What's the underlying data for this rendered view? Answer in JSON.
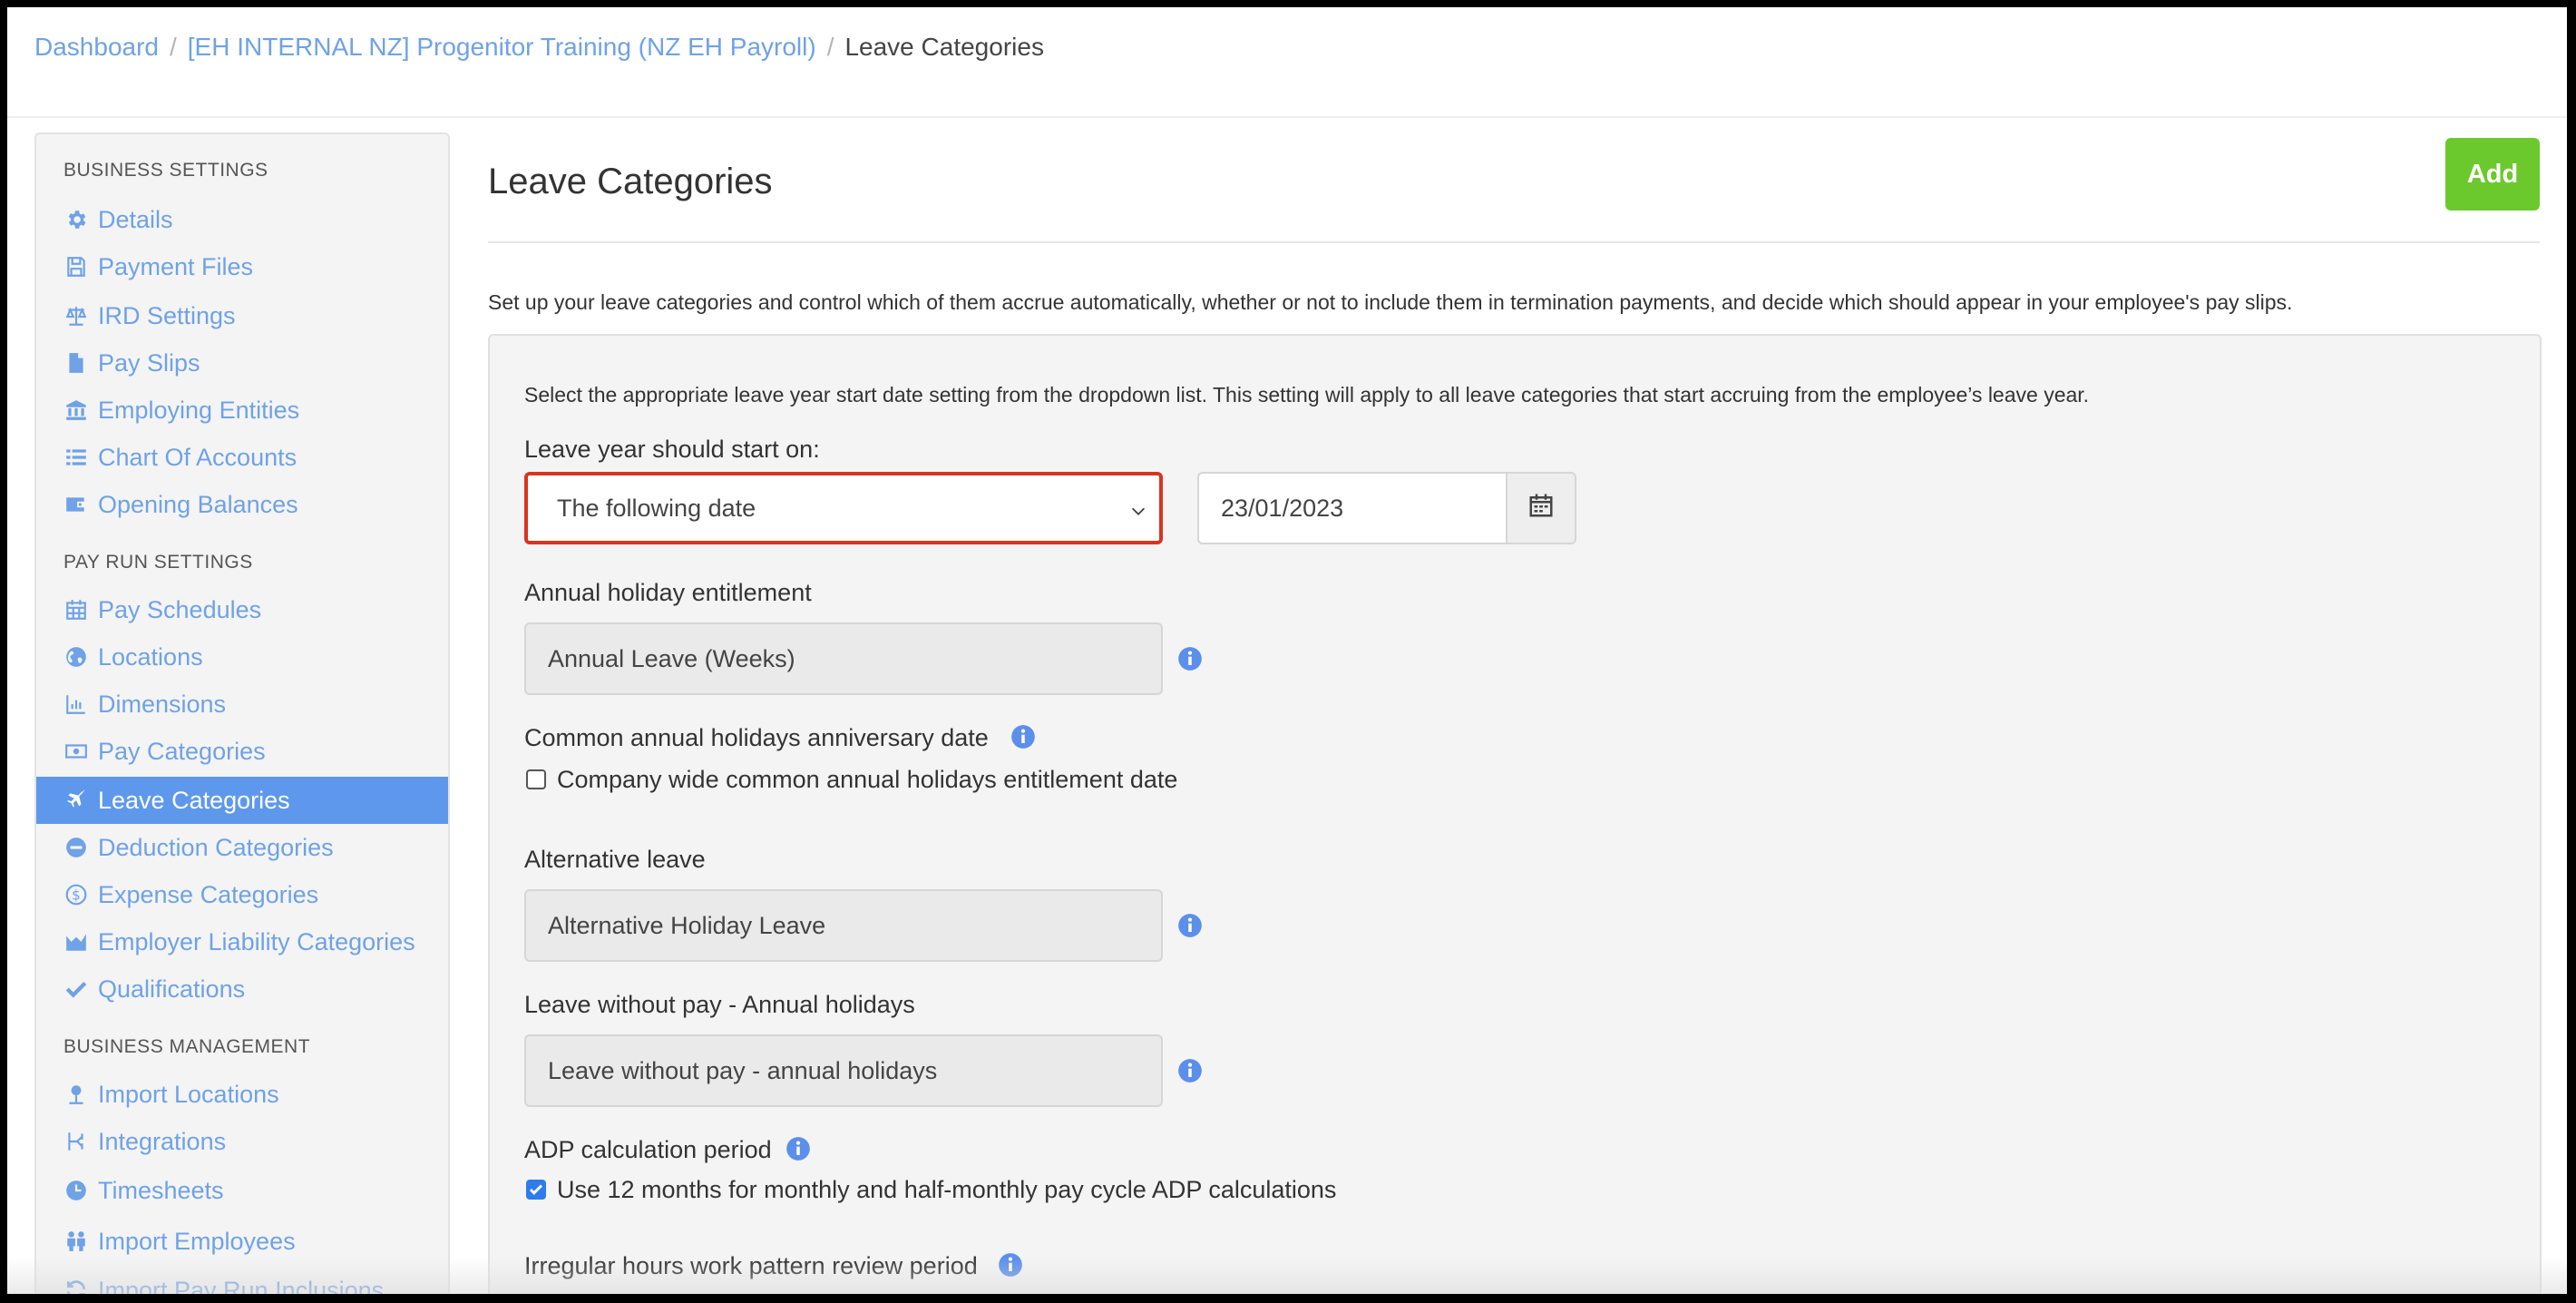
{
  "breadcrumb": {
    "items": [
      {
        "label": "Dashboard"
      },
      {
        "label": "[EH INTERNAL NZ] Progenitor Training (NZ EH Payroll)"
      },
      {
        "label": "Leave Categories"
      }
    ],
    "separator": "/"
  },
  "sidebar": {
    "sections": [
      {
        "heading": "BUSINESS SETTINGS",
        "items": [
          {
            "label": "Details",
            "icon": "gear-icon"
          },
          {
            "label": "Payment Files",
            "icon": "floppy-icon"
          },
          {
            "label": "IRD Settings",
            "icon": "scale-icon"
          },
          {
            "label": "Pay Slips",
            "icon": "file-icon"
          },
          {
            "label": "Employing Entities",
            "icon": "bank-icon"
          },
          {
            "label": "Chart Of Accounts",
            "icon": "list-icon"
          },
          {
            "label": "Opening Balances",
            "icon": "wallet-icon"
          }
        ]
      },
      {
        "heading": "PAY RUN SETTINGS",
        "items": [
          {
            "label": "Pay Schedules",
            "icon": "calendar-icon"
          },
          {
            "label": "Locations",
            "icon": "globe-icon"
          },
          {
            "label": "Dimensions",
            "icon": "bar-chart-icon"
          },
          {
            "label": "Pay Categories",
            "icon": "money-icon"
          },
          {
            "label": "Leave Categories",
            "icon": "plane-icon",
            "active": true
          },
          {
            "label": "Deduction Categories",
            "icon": "minus-circle-icon"
          },
          {
            "label": "Expense Categories",
            "icon": "dollar-circle-icon"
          },
          {
            "label": "Employer Liability Categories",
            "icon": "area-chart-icon"
          },
          {
            "label": "Qualifications",
            "icon": "check-icon"
          }
        ]
      },
      {
        "heading": "BUSINESS MANAGEMENT",
        "items": [
          {
            "label": "Import Locations",
            "icon": "map-pin-icon"
          },
          {
            "label": "Integrations",
            "icon": "share-icon"
          },
          {
            "label": "Timesheets",
            "icon": "clock-icon"
          },
          {
            "label": "Import Employees",
            "icon": "users-icon"
          },
          {
            "label": "Import Pay Run Inclusions",
            "icon": "refresh-icon"
          }
        ]
      }
    ]
  },
  "main": {
    "title": "Leave Categories",
    "add_label": "Add",
    "intro": "Set up your leave categories and control which of them accrue automatically, whether or not to include them in termination payments, and decide which should appear in your employee's pay slips.",
    "panel_note": "Select the appropriate leave year start date setting from the dropdown list. This setting will apply to all leave categories that start accruing from the employee’s leave year.",
    "leave_year": {
      "label": "Leave year should start on:",
      "selected": "The following date",
      "date_value": "23/01/2023"
    },
    "annual_holiday": {
      "label": "Annual holiday entitlement",
      "value": "Annual Leave (Weeks)"
    },
    "common_anniversary": {
      "label": "Common annual holidays anniversary date",
      "checkbox_label": "Company wide common annual holidays entitlement date",
      "checked": false
    },
    "alternative_leave": {
      "label": "Alternative leave",
      "value": "Alternative Holiday Leave"
    },
    "leave_without_pay": {
      "label": "Leave without pay - Annual holidays",
      "value": "Leave without pay - annual holidays"
    },
    "adp": {
      "label": "ADP calculation period",
      "checkbox_label": "Use 12 months for monthly and half-monthly pay cycle ADP calculations",
      "checked": true
    },
    "irregular": {
      "label": "Irregular hours work pattern review period"
    }
  },
  "colors": {
    "link": "#6fa2e6",
    "active_bg": "#5e98ec",
    "add_button": "#6cc92d",
    "focus_border": "#d9341f",
    "info_icon": "#5b8fea",
    "checkbox_checked": "#2f7bea"
  }
}
